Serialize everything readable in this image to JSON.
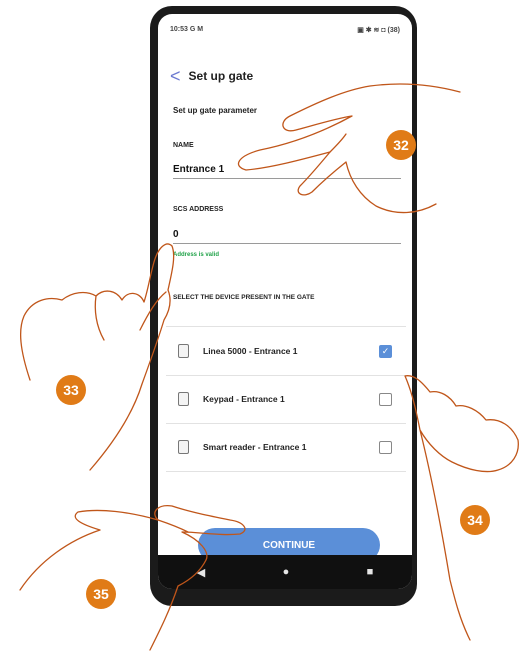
{
  "status_bar": {
    "time": "10:53",
    "left_icons": "G M",
    "right_icons": "▣ ✱ ≋ ◘ (38)"
  },
  "header": {
    "back_symbol": "<",
    "title": "Set up gate"
  },
  "form": {
    "section_title": "Set up gate parameter",
    "name_label": "NAME",
    "name_value": "Entrance 1",
    "address_label": "SCS ADDRESS",
    "address_value": "0",
    "address_status": "Address is valid",
    "devices_title": "SELECT THE DEVICE PRESENT IN THE GATE"
  },
  "devices": [
    {
      "label": "Linea 5000 - Entrance 1",
      "checked": true,
      "icon": "handset-icon"
    },
    {
      "label": "Keypad - Entrance 1",
      "checked": false,
      "icon": "keypad-icon"
    },
    {
      "label": "Smart reader - Entrance 1",
      "checked": false,
      "icon": "reader-icon"
    }
  ],
  "continue_label": "CONTINUE",
  "nav": {
    "back": "◀",
    "home": "●",
    "recent": "■"
  },
  "callouts": {
    "c32": "32",
    "c33": "33",
    "c34": "34",
    "c35": "35"
  },
  "colors": {
    "accent": "#5b8fd8",
    "callout": "#e07b17",
    "valid": "#22a34a",
    "outline": "#c0561a"
  }
}
